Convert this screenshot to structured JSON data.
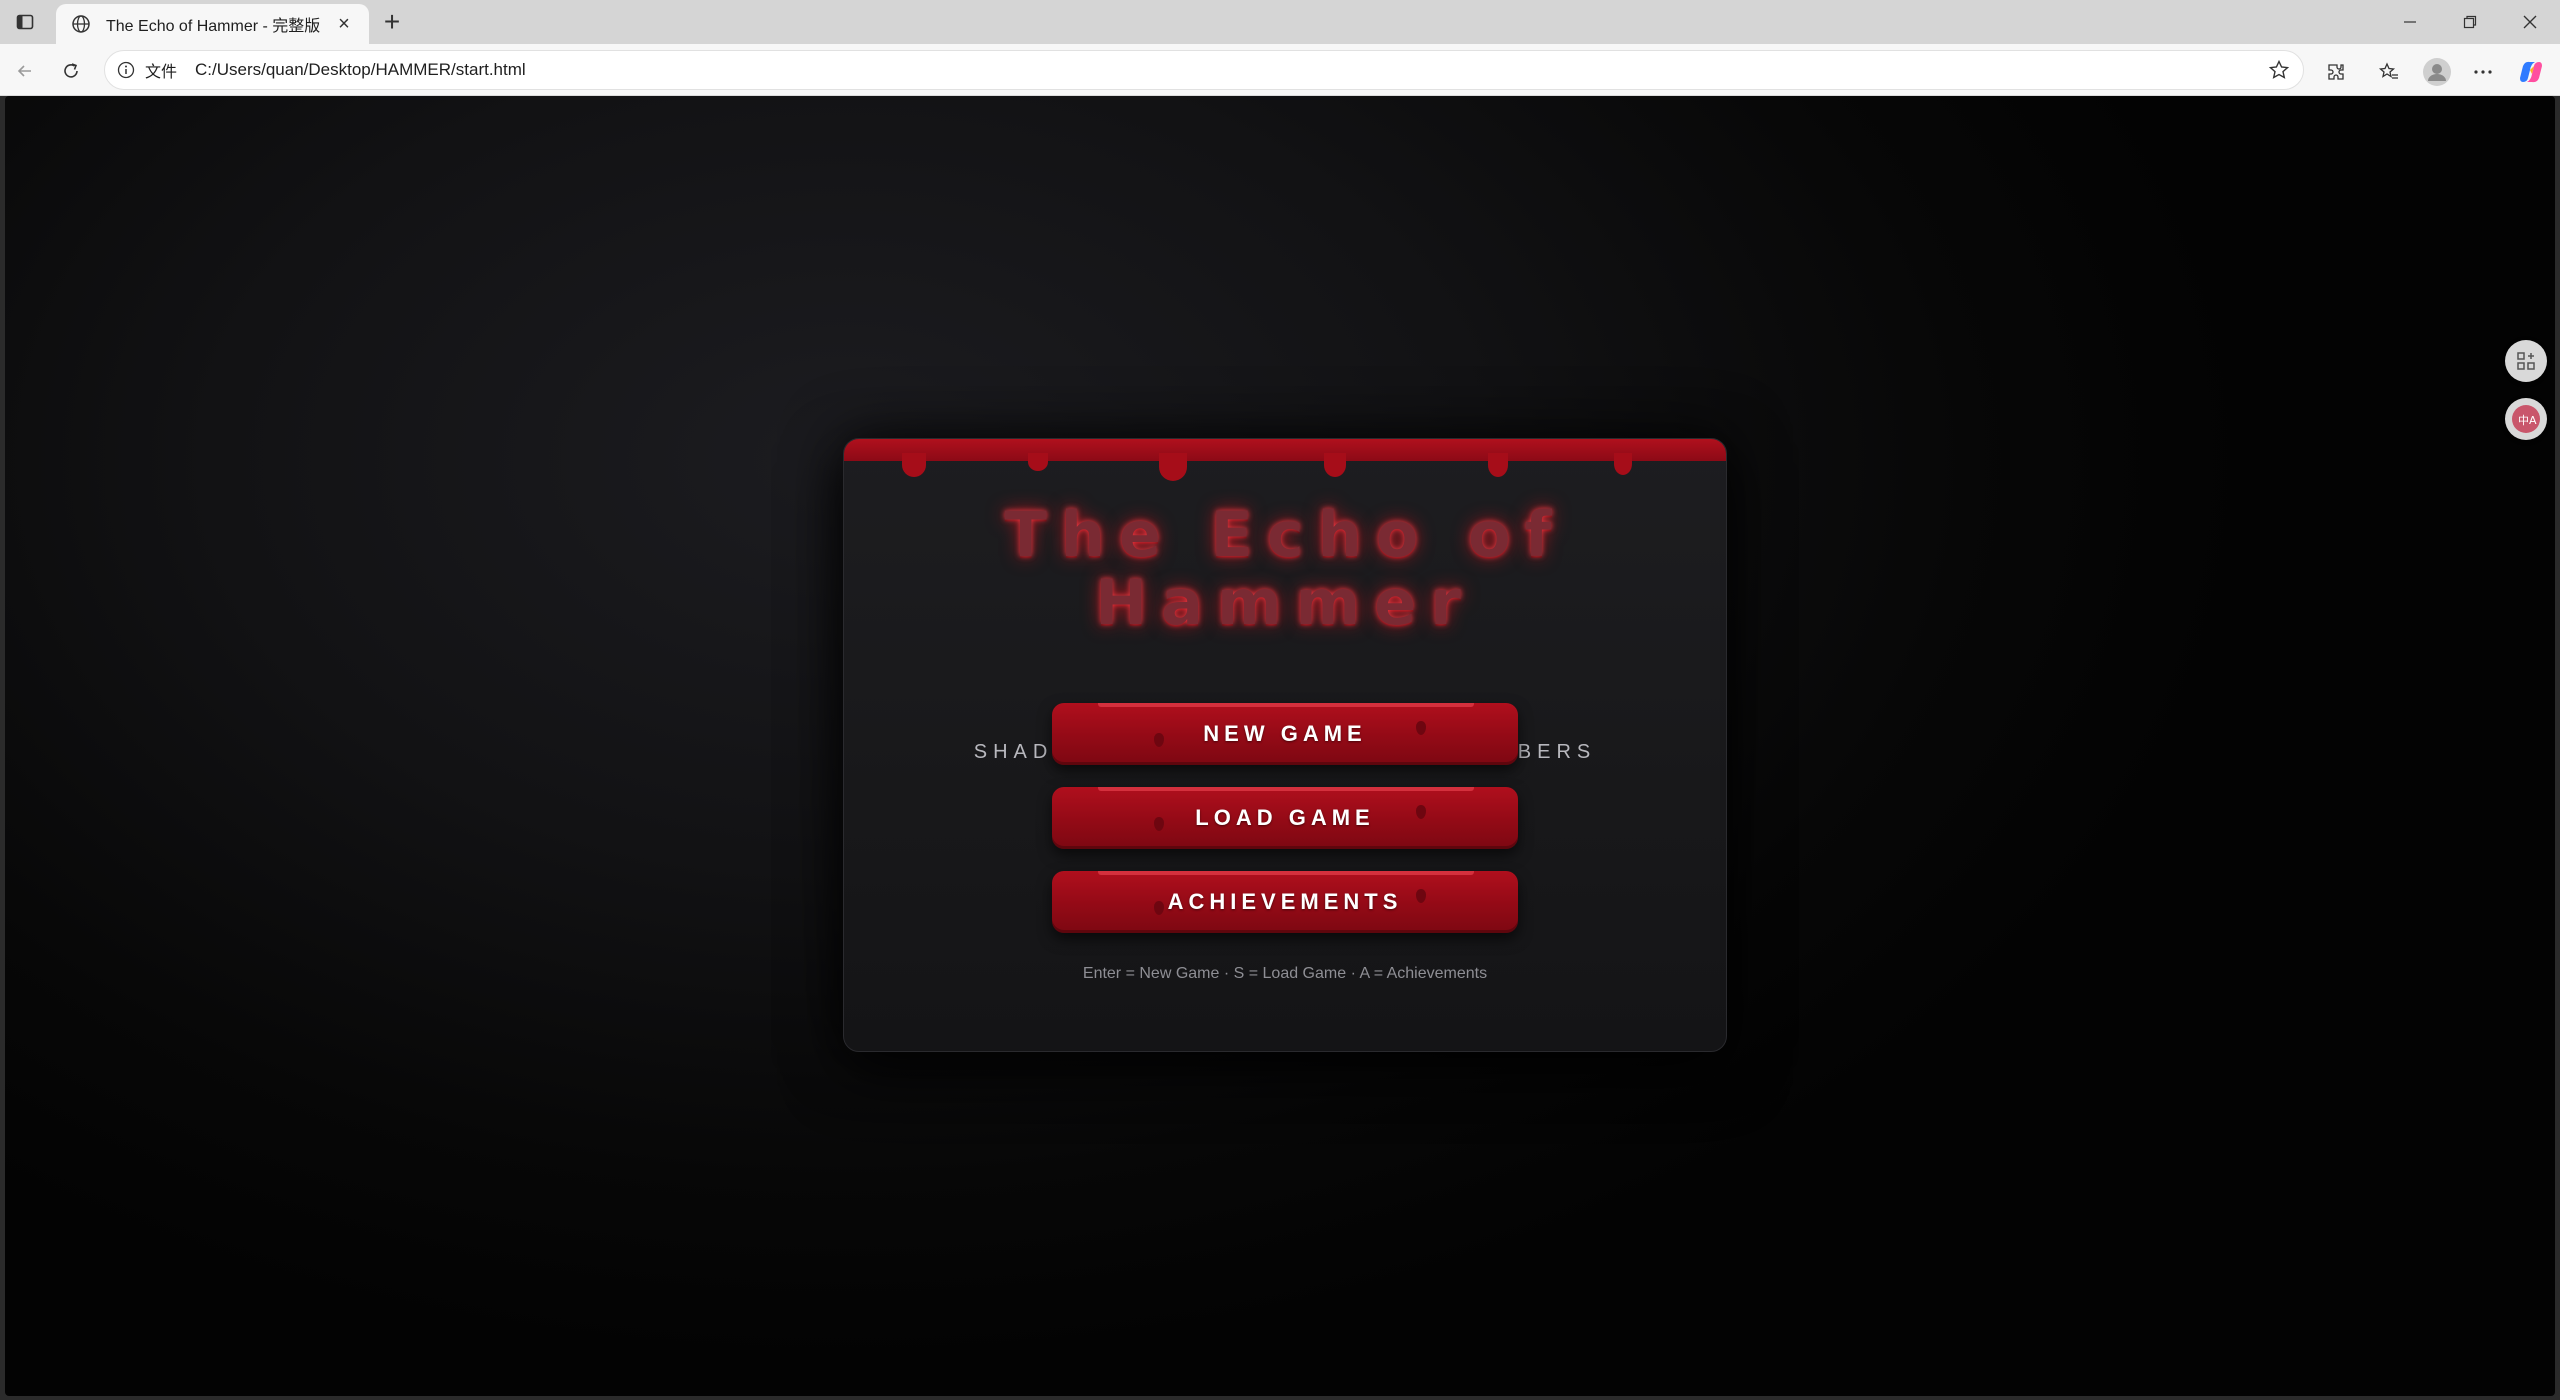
{
  "browser": {
    "tab_title": "The Echo of Hammer - 完整版",
    "new_tab": "+",
    "tab_close": "×",
    "address_scheme": "文件",
    "address_url": "C:/Users/quan/Desktop/HAMMER/start.html"
  },
  "game": {
    "title_line1": "The Echo of",
    "title_line2": "Hammer",
    "subtitle": "SHADOWS WHISPER · BLOOD REMEMBERS",
    "menu": [
      {
        "label": "NEW GAME"
      },
      {
        "label": "LOAD GAME"
      },
      {
        "label": "ACHIEVEMENTS"
      }
    ],
    "hint": "Enter = New Game · S = Load Game · A = Achievements",
    "colors": {
      "blood": "#a60d19",
      "button": "#9a0c18",
      "title_glow": "#e0303c",
      "background": "#0b0b0c"
    }
  },
  "icons": [
    "sidebar-toggle-icon",
    "globe-icon",
    "back-icon",
    "reload-icon",
    "info-icon",
    "star-icon",
    "extensions-icon",
    "favorites-icon",
    "profile-icon",
    "more-icon",
    "copilot-icon",
    "minimize-icon",
    "restore-icon",
    "close-icon",
    "apps-icon",
    "translate-icon"
  ]
}
